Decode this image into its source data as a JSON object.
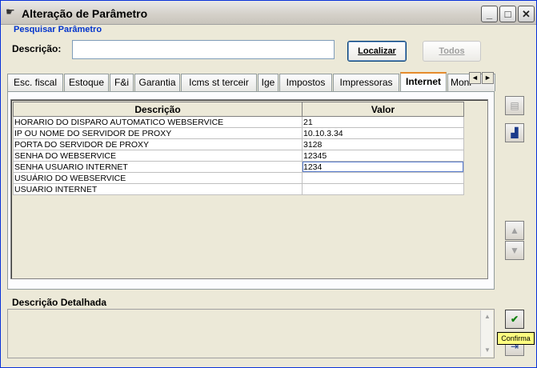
{
  "window": {
    "title": "Alteração de Parâmetro",
    "icon": "hand-key-icon",
    "minimize": "_",
    "maximize": "□",
    "close": "✕"
  },
  "search": {
    "group_title": "Pesquisar Parâmetro",
    "description_label": "Descrição:",
    "description_value": "",
    "localizar_label": "Localizar",
    "todos_label": "Todos"
  },
  "tabs": [
    {
      "label": "Esc. fiscal"
    },
    {
      "label": "Estoque"
    },
    {
      "label": "F&i"
    },
    {
      "label": "Garantia"
    },
    {
      "label": "Icms st terceir"
    },
    {
      "label": "Ige"
    },
    {
      "label": "Impostos"
    },
    {
      "label": "Impressoras"
    },
    {
      "label": "Internet",
      "active": true
    },
    {
      "label": "Moni"
    }
  ],
  "tab_scroll": {
    "left": "◄",
    "right": "►"
  },
  "grid": {
    "headers": {
      "description": "Descrição",
      "value": "Valor"
    },
    "rows": [
      {
        "description": "HORARIO DO DISPARO AUTOMATICO WEBSERVICE",
        "value": "21"
      },
      {
        "description": "IP OU NOME DO SERVIDOR DE PROXY",
        "value": "10.10.3.34"
      },
      {
        "description": "PORTA DO SERVIDOR DE PROXY",
        "value": "3128"
      },
      {
        "description": "SENHA DO WEBSERVICE",
        "value": "12345"
      },
      {
        "description": "SENHA USUARIO INTERNET",
        "value": "1234"
      },
      {
        "description": "USUÁRIO DO WEBSERVICE",
        "value": ""
      },
      {
        "description": "USUARIO INTERNET",
        "value": ""
      }
    ]
  },
  "detail": {
    "label": "Descrição Detalhada",
    "value": ""
  },
  "side_buttons": {
    "grid_config": "grid-icon",
    "chart": "chart-icon",
    "move_up": "▲",
    "move_down": "▼",
    "confirm": "check-icon",
    "exit": "exit-icon"
  },
  "tooltip": {
    "text": "Confirma"
  }
}
